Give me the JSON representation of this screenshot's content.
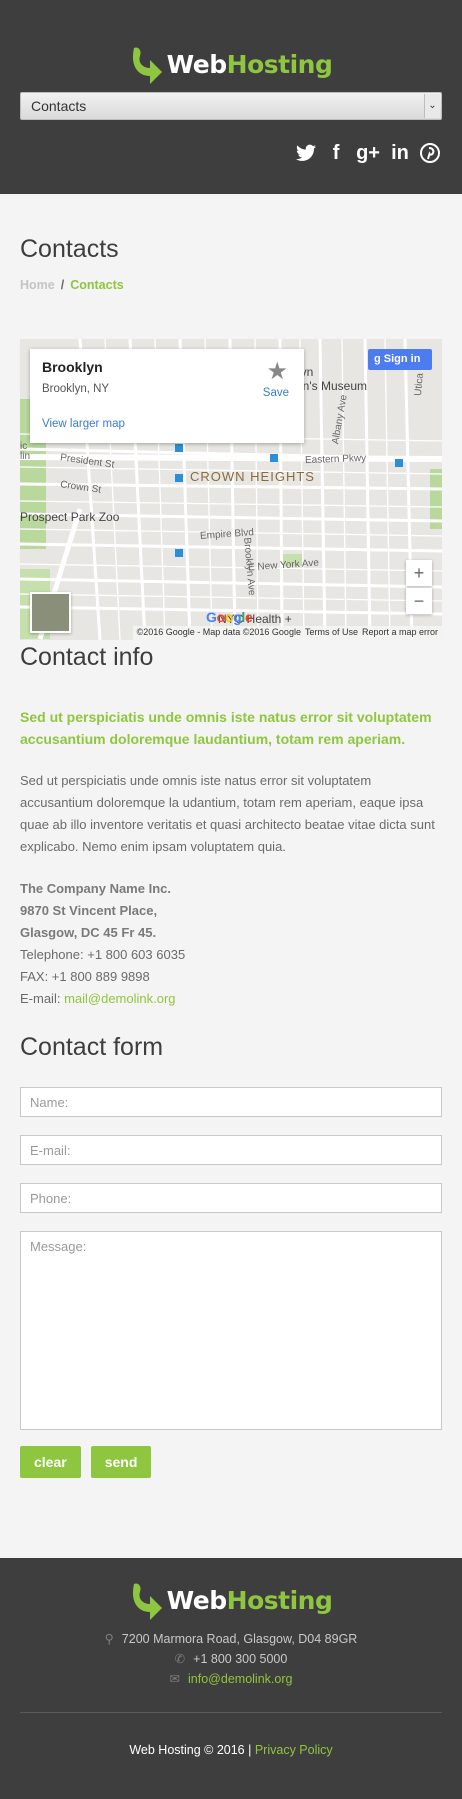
{
  "header": {
    "logo_web": "Web",
    "logo_host": "Hosting",
    "nav_selected": "Contacts",
    "nav_arrow": "⌄",
    "social": [
      "twitter",
      "facebook",
      "google-plus",
      "linkedin",
      "pinterest"
    ],
    "social_glyphs": {
      "facebook": "f",
      "googleplus": "g+",
      "linkedin": "in"
    }
  },
  "page": {
    "title": "Contacts",
    "breadcrumb": {
      "home": "Home",
      "separator": "/",
      "current": "Contacts"
    }
  },
  "map": {
    "place_name": "Brooklyn",
    "place_sub": "Brooklyn, NY",
    "view_larger": "View larger map",
    "save": "Save",
    "save_star": "★",
    "sign_in": "Sign in",
    "zoom_in": "+",
    "zoom_out": "−",
    "google_logo": "Google",
    "copyright": "©2016 Google - Map data ©2016 Google",
    "terms": "Terms of Use",
    "report": "Report a map error",
    "labels": {
      "crown_heights": "CROWN HEIGHTS",
      "prospect_park_zoo": "Prospect Park Zoo",
      "president_st": "President St",
      "crown_st": "Crown St",
      "empire_blvd": "Empire Blvd",
      "e_new_york_ave": "E New York Ave",
      "eastern_pkwy": "Eastern Pkwy",
      "albany_ave": "Albany Ave",
      "brooklyn_ave": "Brooklyn Ave",
      "utica": "Utica",
      "museum_1": "klyn",
      "museum_2": "ren's Museum",
      "nyc_health": "NYC Health +",
      "park_1": "ic",
      "park_2": "lin"
    }
  },
  "contact_info": {
    "title": "Contact info",
    "lead": "Sed ut perspiciatis unde omnis iste natus error sit voluptatem accusantium doloremque laudantium, totam rem aperiam.",
    "body": "Sed ut perspiciatis unde omnis iste natus error sit voluptatem accusantium doloremque la udantium, totam rem aperiam, eaque ipsa quae ab illo inventore veritatis et quasi architecto beatae vitae dicta sunt explicabo. Nemo enim ipsam voluptatem quia.",
    "company": "The Company Name Inc.",
    "street": "9870 St Vincent Place,",
    "city": "Glasgow, DC 45 Fr 45.",
    "telephone": "Telephone: +1 800 603 6035",
    "fax": "FAX: +1 800 889 9898",
    "email_label": "E-mail: ",
    "email": "mail@demolink.org"
  },
  "contact_form": {
    "title": "Contact form",
    "name_placeholder": "Name:",
    "email_placeholder": "E-mail:",
    "phone_placeholder": "Phone:",
    "message_placeholder": "Message:",
    "clear": "clear",
    "send": "send"
  },
  "footer": {
    "logo_web": "Web",
    "logo_host": "Hosting",
    "address": "7200 Marmora Road, Glasgow, D04 89GR",
    "phone": "+1 800 300 5000",
    "email": "info@demolink.org",
    "copyright": "Web Hosting © 2016 | ",
    "privacy": "Privacy Policy",
    "address_icon": "⚲",
    "phone_icon": "✆",
    "email_icon": "✉"
  },
  "colors": {
    "accent": "#8ec63f",
    "header_bg": "#3e3e3e",
    "page_bg": "#f4f4f4"
  }
}
